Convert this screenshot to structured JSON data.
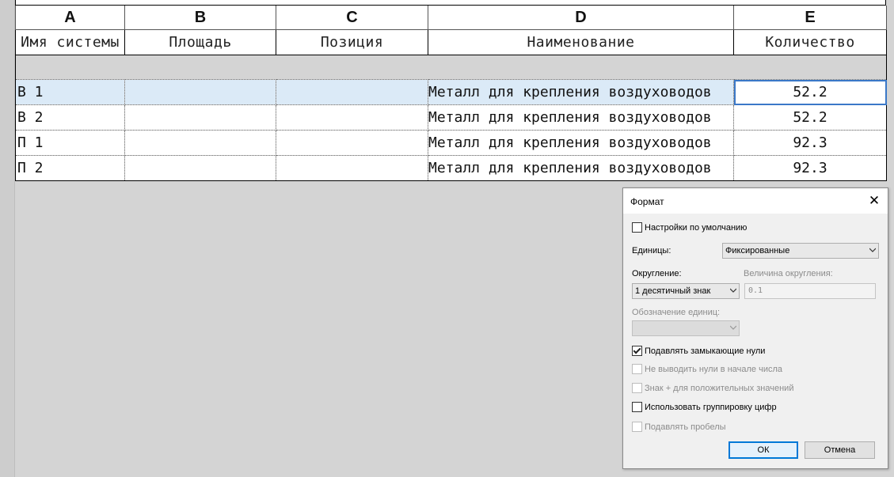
{
  "columns": {
    "letters": [
      "A",
      "B",
      "C",
      "D",
      "E"
    ],
    "headers": [
      "Имя системы",
      "Площадь",
      "Позиция",
      "Наименование",
      "Количество"
    ]
  },
  "rows": [
    {
      "a": "В 1",
      "b": "",
      "c": "",
      "d": "Металл для крепления воздуховодов",
      "e": "52.2"
    },
    {
      "a": "В 2",
      "b": "",
      "c": "",
      "d": "Металл для крепления воздуховодов",
      "e": "52.2"
    },
    {
      "a": "П 1",
      "b": "",
      "c": "",
      "d": "Металл для крепления воздуховодов",
      "e": "92.3"
    },
    {
      "a": "П 2",
      "b": "",
      "c": "",
      "d": "Металл для крепления воздуховодов",
      "e": "92.3"
    }
  ],
  "dialog": {
    "title": "Формат",
    "close_glyph": "✕",
    "use_default_label": "Настройки по умолчанию",
    "units_label": "Единицы:",
    "units_value": "Фиксированные",
    "rounding_label": "Округление:",
    "rounding_value": "1 десятичный знак",
    "rounding_increment_label": "Величина округления:",
    "rounding_increment_value": "0.1",
    "unit_symbol_label": "Обозначение единиц:",
    "unit_symbol_value": "",
    "suppress_trailing_zeros": "Подавлять замыкающие нули",
    "suppress_leading_zeros": "Не выводить нули в начале числа",
    "plus_prefix": "Знак + для положительных значений",
    "digit_grouping": "Использовать группировку цифр",
    "suppress_spaces": "Подавлять пробелы",
    "ok": "ОК",
    "cancel": "Отмена"
  },
  "colors": {
    "selection": "#dbeaf7",
    "active_cell_border": "#3a78c8",
    "background": "#d4d4d4"
  }
}
